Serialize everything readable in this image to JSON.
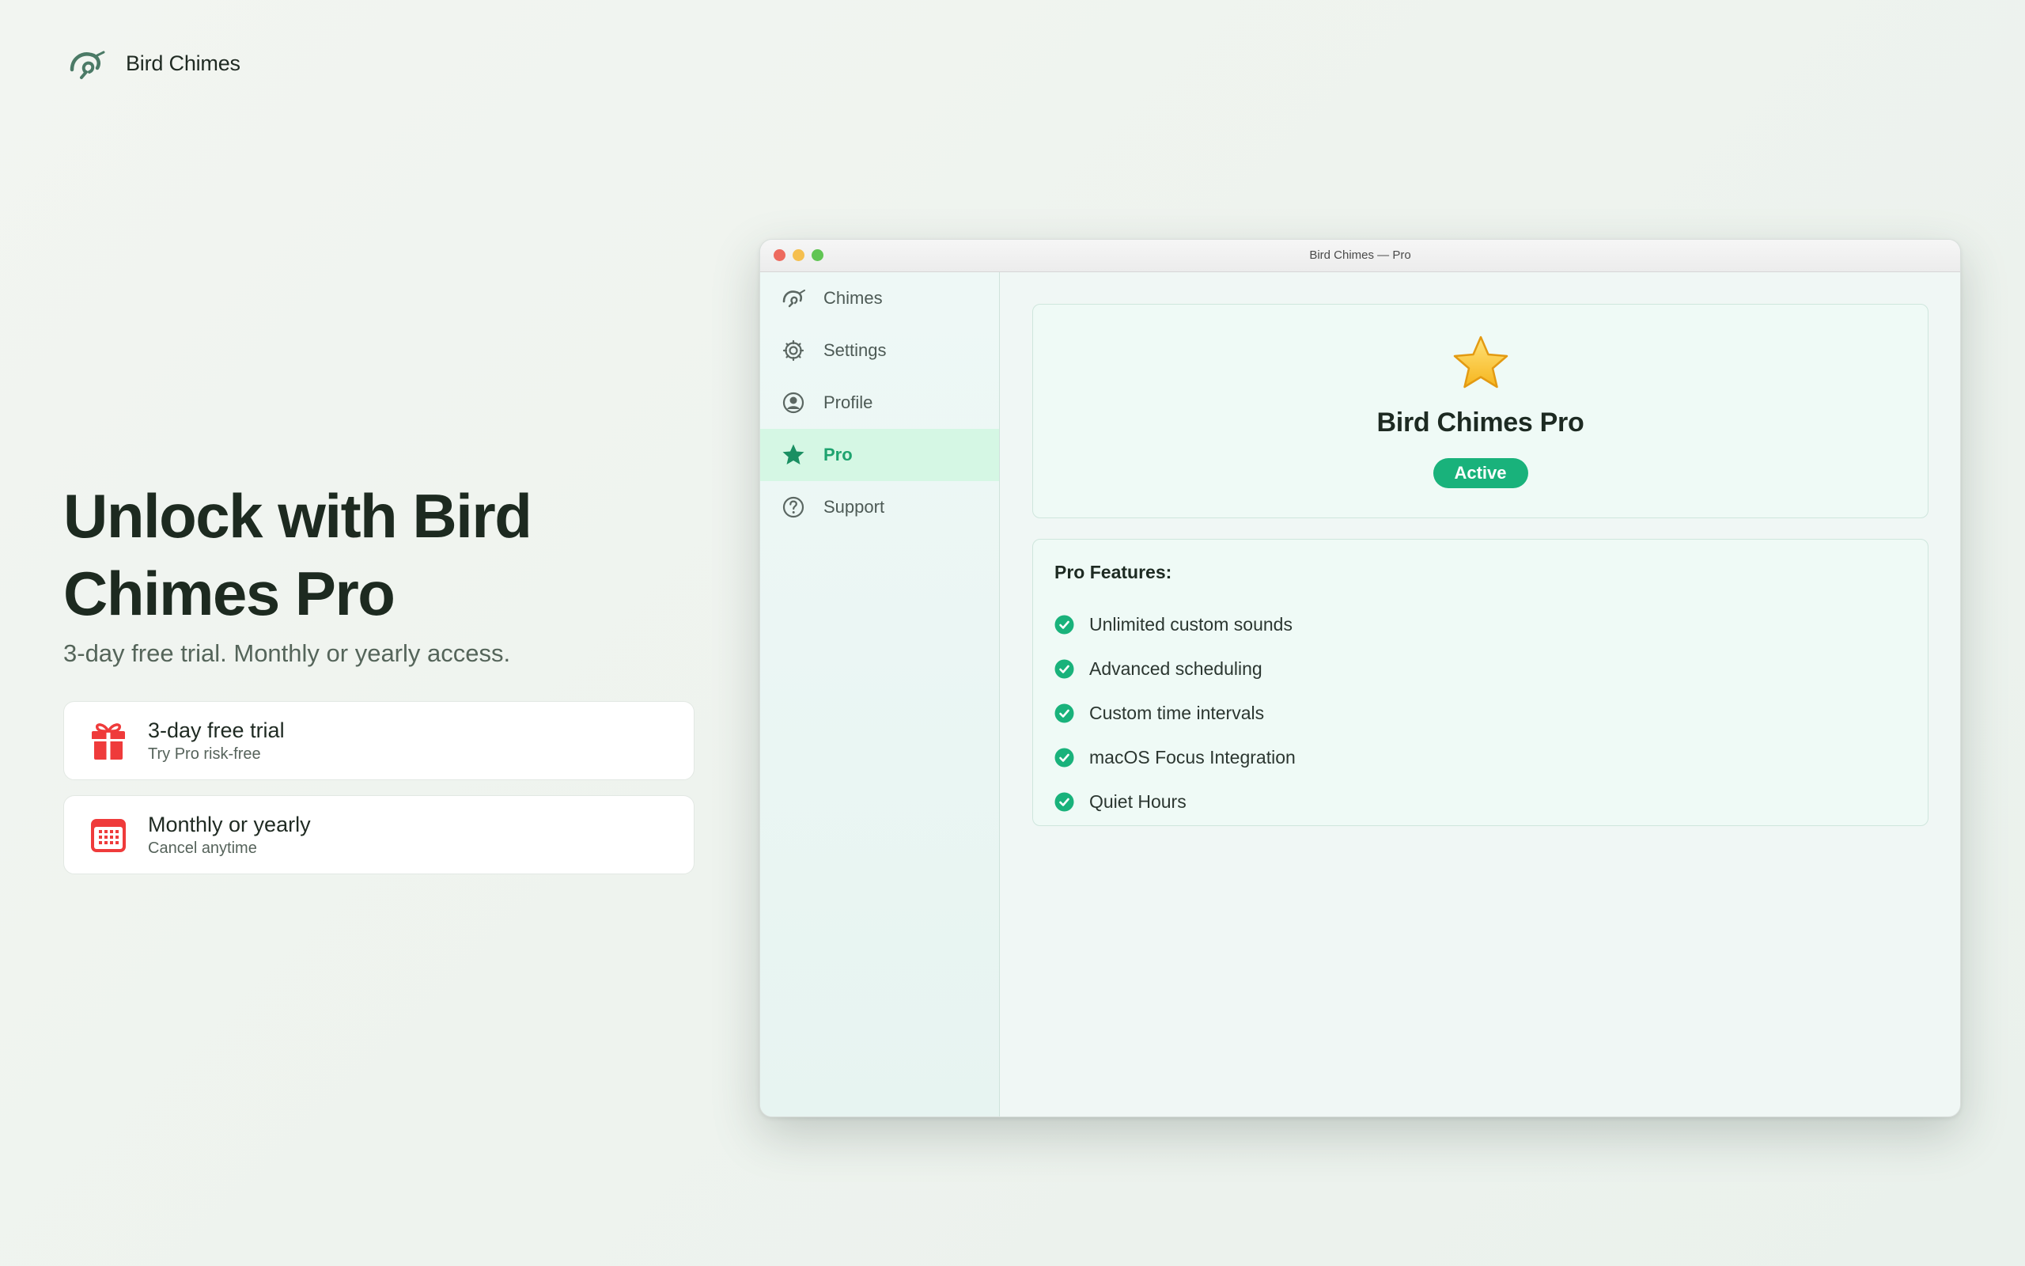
{
  "brand": {
    "name": "Bird Chimes",
    "logo_icon": "bird-chimes-logo-icon"
  },
  "hero": {
    "title": "Unlock with Bird Chimes Pro",
    "subtitle": "3-day free trial. Monthly or yearly access."
  },
  "cards": [
    {
      "icon": "gift-icon",
      "title": "3-day free trial",
      "subtitle": "Try Pro risk-free"
    },
    {
      "icon": "calendar-icon",
      "title": "Monthly or yearly",
      "subtitle": "Cancel anytime"
    }
  ],
  "window": {
    "title": "Bird Chimes — Pro",
    "sidebar": {
      "items": [
        {
          "label": "Chimes",
          "icon": "chime-icon",
          "active": false
        },
        {
          "label": "Settings",
          "icon": "gear-icon",
          "active": false
        },
        {
          "label": "Profile",
          "icon": "person-circle-icon",
          "active": false
        },
        {
          "label": "Pro",
          "icon": "star-icon",
          "active": true
        },
        {
          "label": "Support",
          "icon": "question-circle-icon",
          "active": false
        }
      ]
    },
    "pro": {
      "icon": "star-emoji-icon",
      "title": "Bird Chimes Pro",
      "status": "Active"
    },
    "features": {
      "heading": "Pro Features:",
      "items": [
        "Unlimited custom sounds",
        "Advanced scheduling",
        "Custom time intervals",
        "macOS Focus Integration",
        "Quiet Hours"
      ]
    }
  },
  "colors": {
    "accent_green": "#19b27b",
    "active_nav_bg": "#d5f7e4",
    "gift_red": "#ef3b3b",
    "brand_green": "#4b7a66"
  }
}
